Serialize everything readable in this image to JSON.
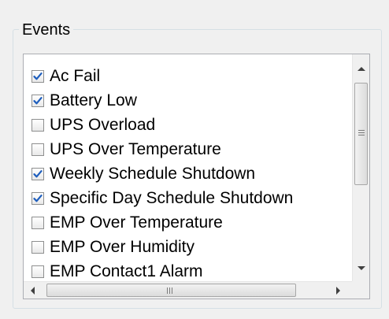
{
  "group": {
    "title": "Events"
  },
  "events": [
    {
      "label": "Ac Fail",
      "checked": true
    },
    {
      "label": "Battery Low",
      "checked": true
    },
    {
      "label": "UPS Overload",
      "checked": false
    },
    {
      "label": "UPS Over Temperature",
      "checked": false
    },
    {
      "label": "Weekly Schedule Shutdown",
      "checked": true
    },
    {
      "label": "Specific Day Schedule Shutdown",
      "checked": true
    },
    {
      "label": "EMP Over Temperature",
      "checked": false
    },
    {
      "label": "EMP Over Humidity",
      "checked": false
    },
    {
      "label": "EMP Contact1 Alarm",
      "checked": false
    }
  ],
  "colors": {
    "checkmark": "#1e5ebd",
    "border": "#8e8f8f"
  }
}
